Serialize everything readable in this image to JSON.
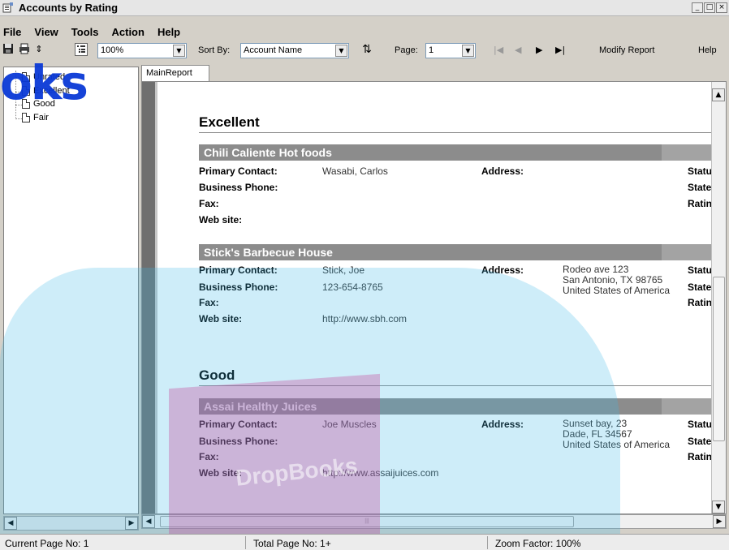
{
  "window": {
    "title": "Accounts by Rating",
    "buttons": [
      "_",
      "□",
      "×"
    ]
  },
  "menu": [
    "File",
    "View",
    "Tools",
    "Action",
    "Help"
  ],
  "toolbar": {
    "zoom": "100%",
    "sort_label": "Sort By:",
    "sort_value": "Account Name",
    "page_label": "Page:",
    "page_value": "1",
    "modify_report": "Modify Report",
    "help": "Help"
  },
  "tree": {
    "items": [
      "Unrated",
      "Excellent",
      "Good",
      "Fair"
    ]
  },
  "tab": "MainReport",
  "report": {
    "labels": {
      "primary_contact": "Primary Contact:",
      "business_phone": "Business Phone:",
      "fax": "Fax:",
      "web_site": "Web site:",
      "address": "Address:",
      "status": "Statu",
      "state": "State",
      "rating": "Ratin"
    },
    "groups": [
      {
        "rating": "Excellent",
        "accounts": [
          {
            "name": "Chili Caliente Hot foods",
            "contact": "Wasabi, Carlos",
            "phone": "",
            "fax": "",
            "web": "",
            "address": [
              "",
              "",
              ""
            ]
          },
          {
            "name": "Stick's Barbecue House",
            "contact": "Stick, Joe",
            "phone": "123-654-8765",
            "fax": "",
            "web": "http://www.sbh.com",
            "address": [
              "Rodeo ave 123",
              "San Antonio, TX 98765",
              "United States of America"
            ]
          }
        ]
      },
      {
        "rating": "Good",
        "accounts": [
          {
            "name": "Assai Healthy Juices",
            "contact": "Joe Muscles",
            "phone": "",
            "fax": "",
            "web": "http://www.assaijuices.com",
            "address": [
              "Sunset bay, 23",
              "Dade, FL 34567",
              "United States of America"
            ]
          }
        ]
      }
    ]
  },
  "status": {
    "current_page": "Current Page No: 1",
    "total_page": "Total Page No: 1+",
    "zoom": "Zoom Factor: 100%"
  },
  "watermark": {
    "text": "oks",
    "logo_text": "DropBooks"
  }
}
